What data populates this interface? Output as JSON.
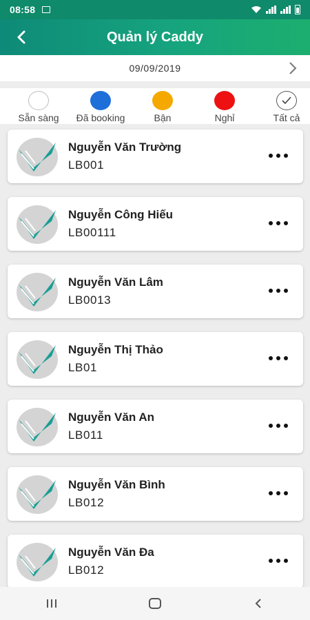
{
  "status_bar": {
    "time": "08:58"
  },
  "header": {
    "title": "Quản lý Caddy"
  },
  "date_bar": {
    "date": "09/09/2019"
  },
  "filters": [
    {
      "label": "Sẵn sàng",
      "color": "#ffffff"
    },
    {
      "label": "Đã booking",
      "color": "#1e6fd9"
    },
    {
      "label": "Bận",
      "color": "#f5a800"
    },
    {
      "label": "Nghỉ",
      "color": "#ee1111"
    },
    {
      "label": "Tất cả",
      "icon": "check-icon"
    }
  ],
  "caddies": [
    {
      "name": "Nguyễn Văn Trường",
      "code": "LB001"
    },
    {
      "name": "Nguyễn Công Hiếu",
      "code": "LB00111"
    },
    {
      "name": "Nguyễn Văn Lâm",
      "code": "LB0013"
    },
    {
      "name": "Nguyễn Thị Thảo",
      "code": "LB01"
    },
    {
      "name": "Nguyễn Văn An",
      "code": "LB011"
    },
    {
      "name": "Nguyễn Văn Bình",
      "code": "LB012"
    },
    {
      "name": "Nguyễn Văn Đa",
      "code": "LB012"
    }
  ],
  "colors": {
    "header_start": "#0e8a78",
    "header_end": "#1cae6f",
    "status_bar": "#0f8a6a",
    "avatar_teal": "#1a9e95"
  }
}
